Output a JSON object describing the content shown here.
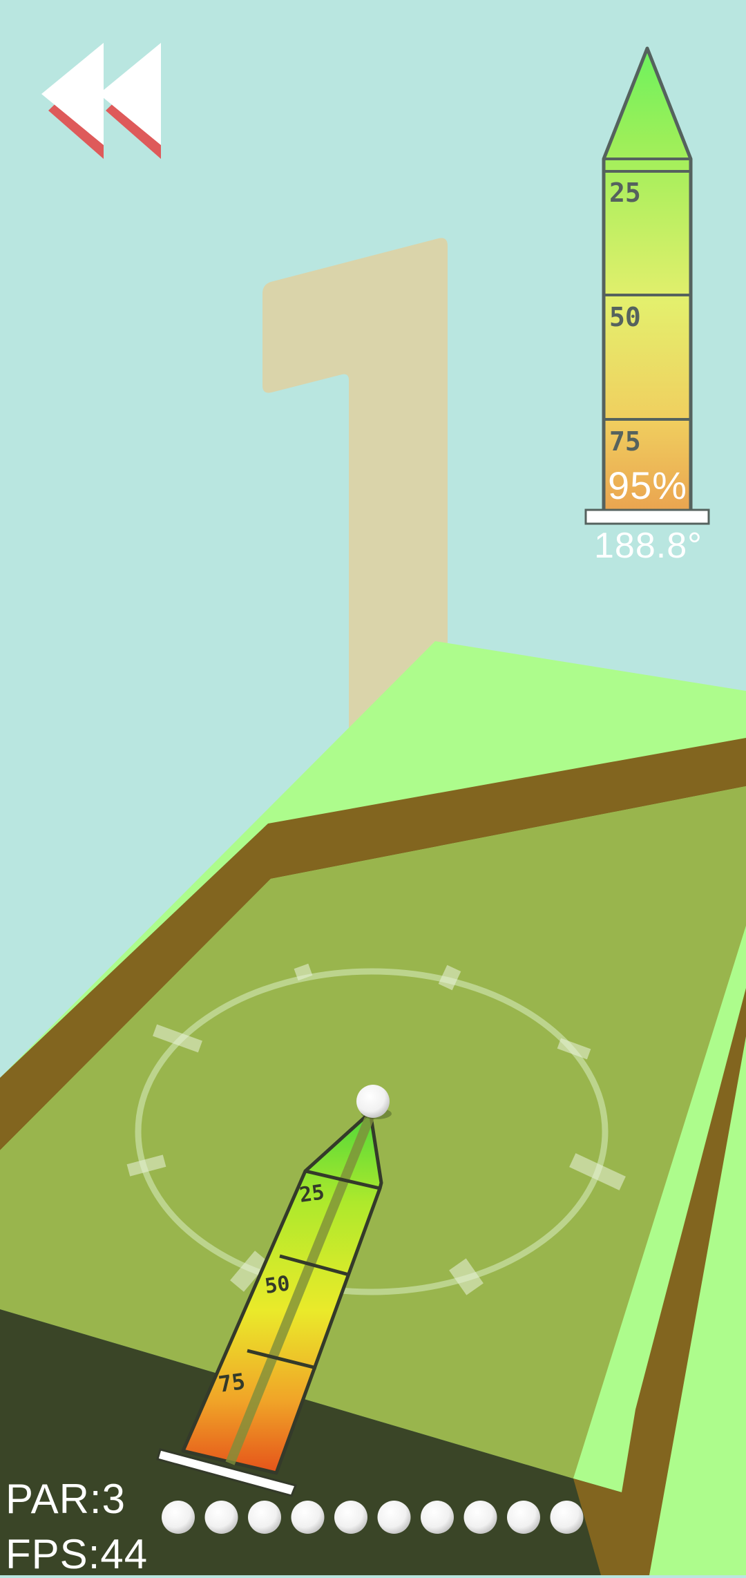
{
  "hud": {
    "back_button": {
      "icon": "rewind-icon",
      "colors": {
        "fill": "#ffffff",
        "shadow": "#de5a5a"
      }
    },
    "power_meter": {
      "marks": [
        "25",
        "50",
        "75"
      ],
      "percent_text": "95%",
      "power_fraction": 0.95,
      "angle_text": "188.8°"
    },
    "par_label": "PAR:",
    "par_value": "3",
    "fps_label": "FPS:",
    "fps_value": "44",
    "balls_remaining": 10
  },
  "course": {
    "hole_number": "1",
    "colors": {
      "sky": "#b9e6e0",
      "number": "#dad4aa",
      "grass": "#99b54d",
      "rail_top": "#adfc8c",
      "rail_wall": "#82651f",
      "shadow": "#3a4527"
    }
  },
  "aim_arrow": {
    "marks": [
      "25",
      "50",
      "75"
    ]
  }
}
